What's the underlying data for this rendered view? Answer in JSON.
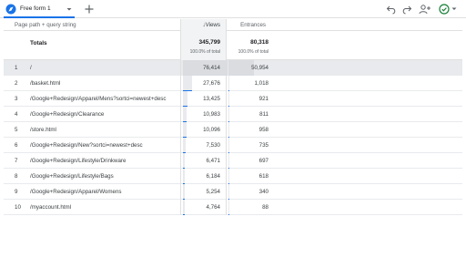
{
  "tab": {
    "label": "Free form 1"
  },
  "columns": {
    "dimension": "Page path + query string",
    "views": "↓Views",
    "entrances": "Entrances"
  },
  "totals": {
    "label": "Totals",
    "views": "345,799",
    "views_pct": "100.0% of total",
    "entrances": "80,318",
    "entrances_pct": "100.0% of total",
    "views_total": 345799,
    "entrances_total": 80318
  },
  "rows": [
    {
      "index": "1",
      "path": "/",
      "views": "76,414",
      "entrances": "50,954",
      "views_num": 76414,
      "entrances_num": 50954
    },
    {
      "index": "2",
      "path": "/basket.html",
      "views": "27,676",
      "entrances": "1,018",
      "views_num": 27676,
      "entrances_num": 1018
    },
    {
      "index": "3",
      "path": "/Google+Redesign/Apparel/Mens?sortci=newest+desc",
      "views": "13,425",
      "entrances": "921",
      "views_num": 13425,
      "entrances_num": 921
    },
    {
      "index": "4",
      "path": "/Google+Redesign/Clearance",
      "views": "10,983",
      "entrances": "811",
      "views_num": 10983,
      "entrances_num": 811
    },
    {
      "index": "5",
      "path": "/store.html",
      "views": "10,096",
      "entrances": "958",
      "views_num": 10096,
      "entrances_num": 958
    },
    {
      "index": "6",
      "path": "/Google+Redesign/New?sortci=newest+desc",
      "views": "7,530",
      "entrances": "735",
      "views_num": 7530,
      "entrances_num": 735
    },
    {
      "index": "7",
      "path": "/Google+Redesign/Lifestyle/Drinkware",
      "views": "6,471",
      "entrances": "697",
      "views_num": 6471,
      "entrances_num": 697
    },
    {
      "index": "8",
      "path": "/Google+Redesign/Lifestyle/Bags",
      "views": "6,184",
      "entrances": "618",
      "views_num": 6184,
      "entrances_num": 618
    },
    {
      "index": "9",
      "path": "/Google+Redesign/Apparel/Womens",
      "views": "5,254",
      "entrances": "340",
      "views_num": 5254,
      "entrances_num": 340
    },
    {
      "index": "10",
      "path": "/myaccount.html",
      "views": "4,764",
      "entrances": "88",
      "views_num": 4764,
      "entrances_num": 88
    }
  ],
  "icons": {
    "tab": "explore-freeform-icon",
    "caret": "dropdown-caret-icon",
    "add": "add-tab-icon",
    "undo": "undo-icon",
    "redo": "redo-icon",
    "share": "share-person-add-icon",
    "status": "check-circle-status-icon"
  },
  "colors": {
    "accent": "#1a73e8",
    "status": "#188038",
    "bar": "#e8eaed"
  }
}
